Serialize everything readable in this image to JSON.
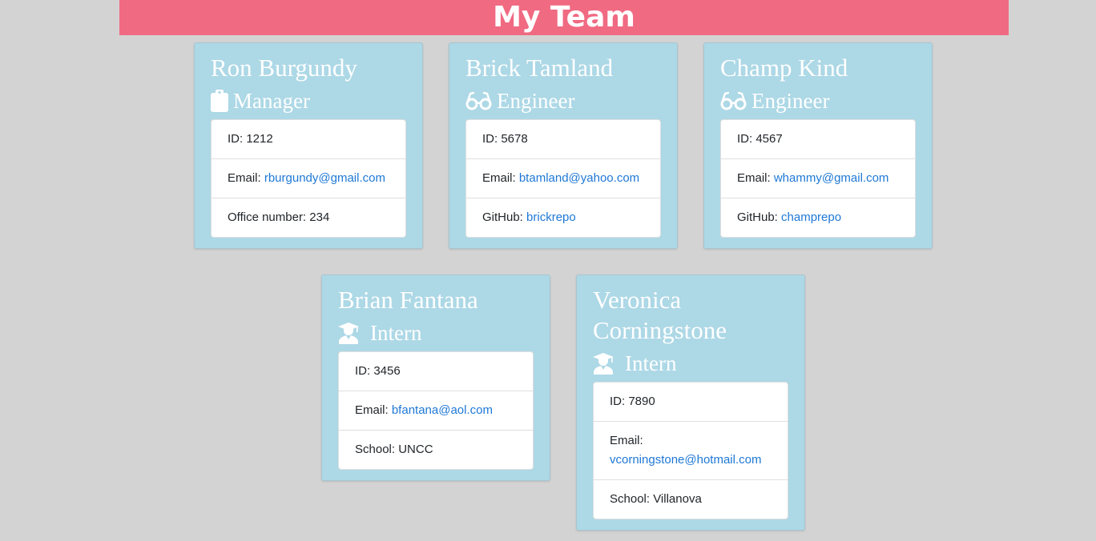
{
  "header": {
    "title": "My Team"
  },
  "team": [
    {
      "name": "Ron Burgundy",
      "role": "Manager",
      "role_icon": "clipboard-icon",
      "id_label": "ID: ",
      "id": "1212",
      "email_label": "Email: ",
      "email": "rburgundy@gmail.com",
      "extra_label": "Office number: ",
      "extra": "234"
    },
    {
      "name": "Brick Tamland",
      "role": "Engineer",
      "role_icon": "glasses-icon",
      "id_label": "ID: ",
      "id": "5678",
      "email_label": "Email: ",
      "email": "btamland@yahoo.com",
      "extra_label": "GitHub: ",
      "extra": "brickrepo"
    },
    {
      "name": "Champ Kind",
      "role": "Engineer",
      "role_icon": "glasses-icon",
      "id_label": "ID: ",
      "id": "4567",
      "email_label": "Email: ",
      "email": "whammy@gmail.com",
      "extra_label": "GitHub: ",
      "extra": "champrepo"
    },
    {
      "name": "Brian Fantana",
      "role": "Intern",
      "role_icon": "graduate-icon",
      "id_label": "ID: ",
      "id": "3456",
      "email_label": "Email: ",
      "email": "bfantana@aol.com",
      "extra_label": "School: ",
      "extra": "UNCC"
    },
    {
      "name": "Veronica Corningstone",
      "role": "Intern",
      "role_icon": "graduate-icon",
      "id_label": "ID: ",
      "id": "7890",
      "email_label": "Email: ",
      "email": "vcorningstone@hotmail.com",
      "extra_label": "School: ",
      "extra": "Villanova"
    }
  ],
  "colors": {
    "banner": "#f06a82",
    "card": "#add8e6",
    "page": "#d3d3d3",
    "link": "#1e78d6"
  }
}
